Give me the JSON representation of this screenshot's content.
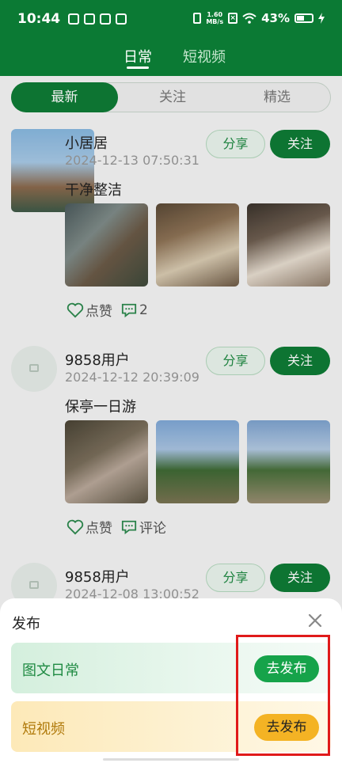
{
  "status_bar": {
    "time": "10:44",
    "net_speed_value": "1.60",
    "net_speed_unit": "MB/s",
    "battery": "43%"
  },
  "top_tabs": [
    "日常",
    "短视频"
  ],
  "segments": [
    "最新",
    "关注",
    "精选"
  ],
  "buttons": {
    "share": "分享",
    "follow": "关注"
  },
  "posts": [
    {
      "user": "小居居",
      "time": "2024-12-13 07:50:31",
      "text": "干净整洁",
      "like": "点赞",
      "comment": "2"
    },
    {
      "user": "9858用户",
      "time": "2024-12-12 20:39:09",
      "text": "保亭一日游",
      "like": "点赞",
      "comment": "评论"
    },
    {
      "user": "9858用户",
      "time": "2024-12-08 13:00:52"
    }
  ],
  "sheet": {
    "title": "发布",
    "options": [
      {
        "label": "图文日常",
        "button": "去发布"
      },
      {
        "label": "短视频",
        "button": "去发布"
      }
    ]
  },
  "colors": {
    "brand_green": "#0e7c36",
    "highlight_red": "#e01a1a",
    "video_yellow": "#f4b324"
  }
}
